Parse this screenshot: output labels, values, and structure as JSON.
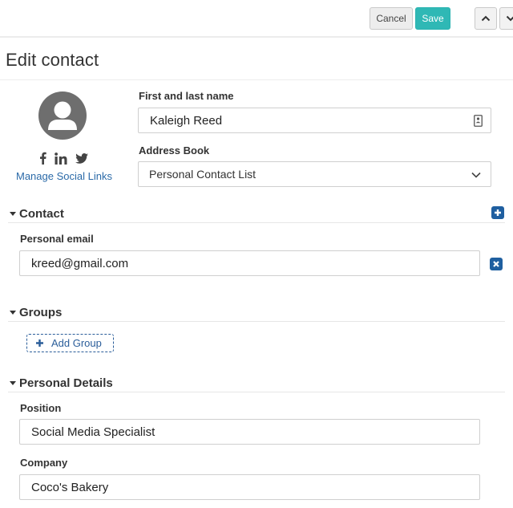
{
  "toolbar": {
    "cancel_label": "Cancel",
    "save_label": "Save",
    "accent_color": "#2fb8b5",
    "prev_icon": "chevron-up-icon",
    "next_icon": "chevron-down-icon"
  },
  "page": {
    "title": "Edit contact"
  },
  "profile": {
    "avatar_icon": "user-silhouette-icon",
    "social_icons": [
      "facebook-icon",
      "linkedin-icon",
      "twitter-icon"
    ],
    "manage_social_label": "Manage Social Links"
  },
  "form": {
    "name_label": "First and last name",
    "name_value": "Kaleigh Reed",
    "name_field_icon": "contact-card-icon",
    "address_book_label": "Address Book",
    "address_book_value": "Personal Contact List"
  },
  "sections": {
    "contact": {
      "title": "Contact",
      "add_icon": "plus-square-icon",
      "email_label": "Personal email",
      "email_value": "kreed@gmail.com",
      "remove_icon": "close-square-icon"
    },
    "groups": {
      "title": "Groups",
      "add_group_label": "Add Group"
    },
    "personal_details": {
      "title": "Personal Details",
      "position_label": "Position",
      "position_value": "Social Media Specialist",
      "company_label": "Company",
      "company_value": "Coco's Bakery"
    }
  },
  "colors": {
    "link": "#2b6aa8",
    "icon_button": "#1f5fa0"
  }
}
